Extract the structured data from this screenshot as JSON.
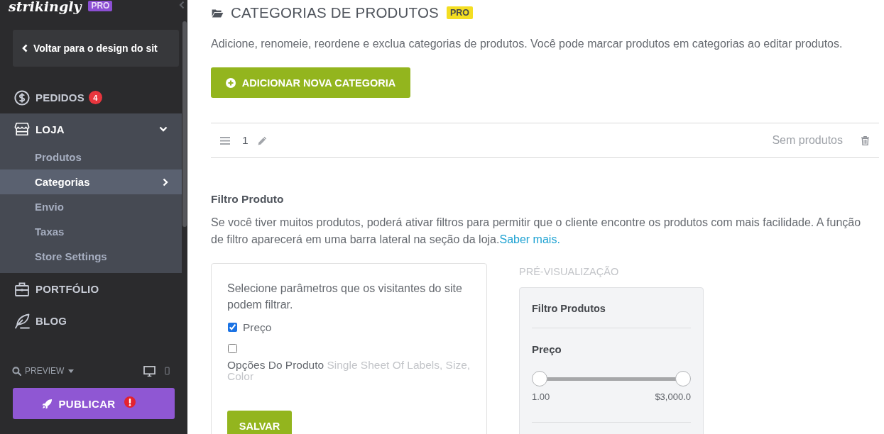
{
  "sidebar": {
    "logo": {
      "wordmark": "strikingly",
      "badge": "PRO"
    },
    "back_button": "Voltar para o design do sit",
    "nav": [
      {
        "label": "PEDIDOS",
        "badge": "4",
        "expanded": false
      },
      {
        "label": "LOJA",
        "expanded": true,
        "children": [
          {
            "label": "Produtos",
            "selected": false
          },
          {
            "label": "Categorias",
            "selected": true
          },
          {
            "label": "Envio",
            "selected": false
          },
          {
            "label": "Taxas",
            "selected": false
          },
          {
            "label": "Store Settings",
            "selected": false
          }
        ]
      },
      {
        "label": "PORTFÓLIO",
        "expanded": false
      },
      {
        "label": "BLOG",
        "expanded": false
      }
    ],
    "preview": {
      "label": "PREVIEW",
      "view_modes": [
        {
          "selected": true
        },
        {
          "selected": false
        }
      ]
    },
    "publish_button": {
      "label": "PUBLICAR",
      "alert": true
    }
  },
  "page": {
    "title": "CATEGORIAS DE PRODUTOS",
    "badge": "PRO",
    "description": "Adicione, renomeie, reordene e exclua categorias de produtos. Você pode marcar produtos em categorias ao editar produtos.",
    "add_button": "ADICIONAR NOVA CATEGORIA"
  },
  "categories": [
    {
      "name": "1",
      "status": "Sem produtos"
    }
  ],
  "filter": {
    "title": "Filtro Produto",
    "description": "Se você tiver muitos produtos, poderá ativar filtros para permitir que o cliente encontre os produtos com mais facilidade. A função de filtro aparecerá em uma barra lateral na seção da loja.",
    "link": "Saber mais.",
    "prompt": "Selecione parâmetros que os visitantes do site podem filtrar.",
    "options": [
      {
        "label": "Preço",
        "checked": true
      },
      {
        "label": "Opções Do Produto",
        "detail": "Single Sheet Of Labels, Size, Color",
        "checked": false
      }
    ],
    "save_button": "SALVAR"
  },
  "preview": {
    "label": "PRÉ-VISUALIZAÇÃO",
    "title": "Filtro Produtos",
    "price_label": "Preço",
    "slider": {
      "thumbs": [
        {
          "level": 0
        },
        {
          "level": 1
        }
      ]
    },
    "min": "1.00",
    "max": "$3,000.0"
  }
}
